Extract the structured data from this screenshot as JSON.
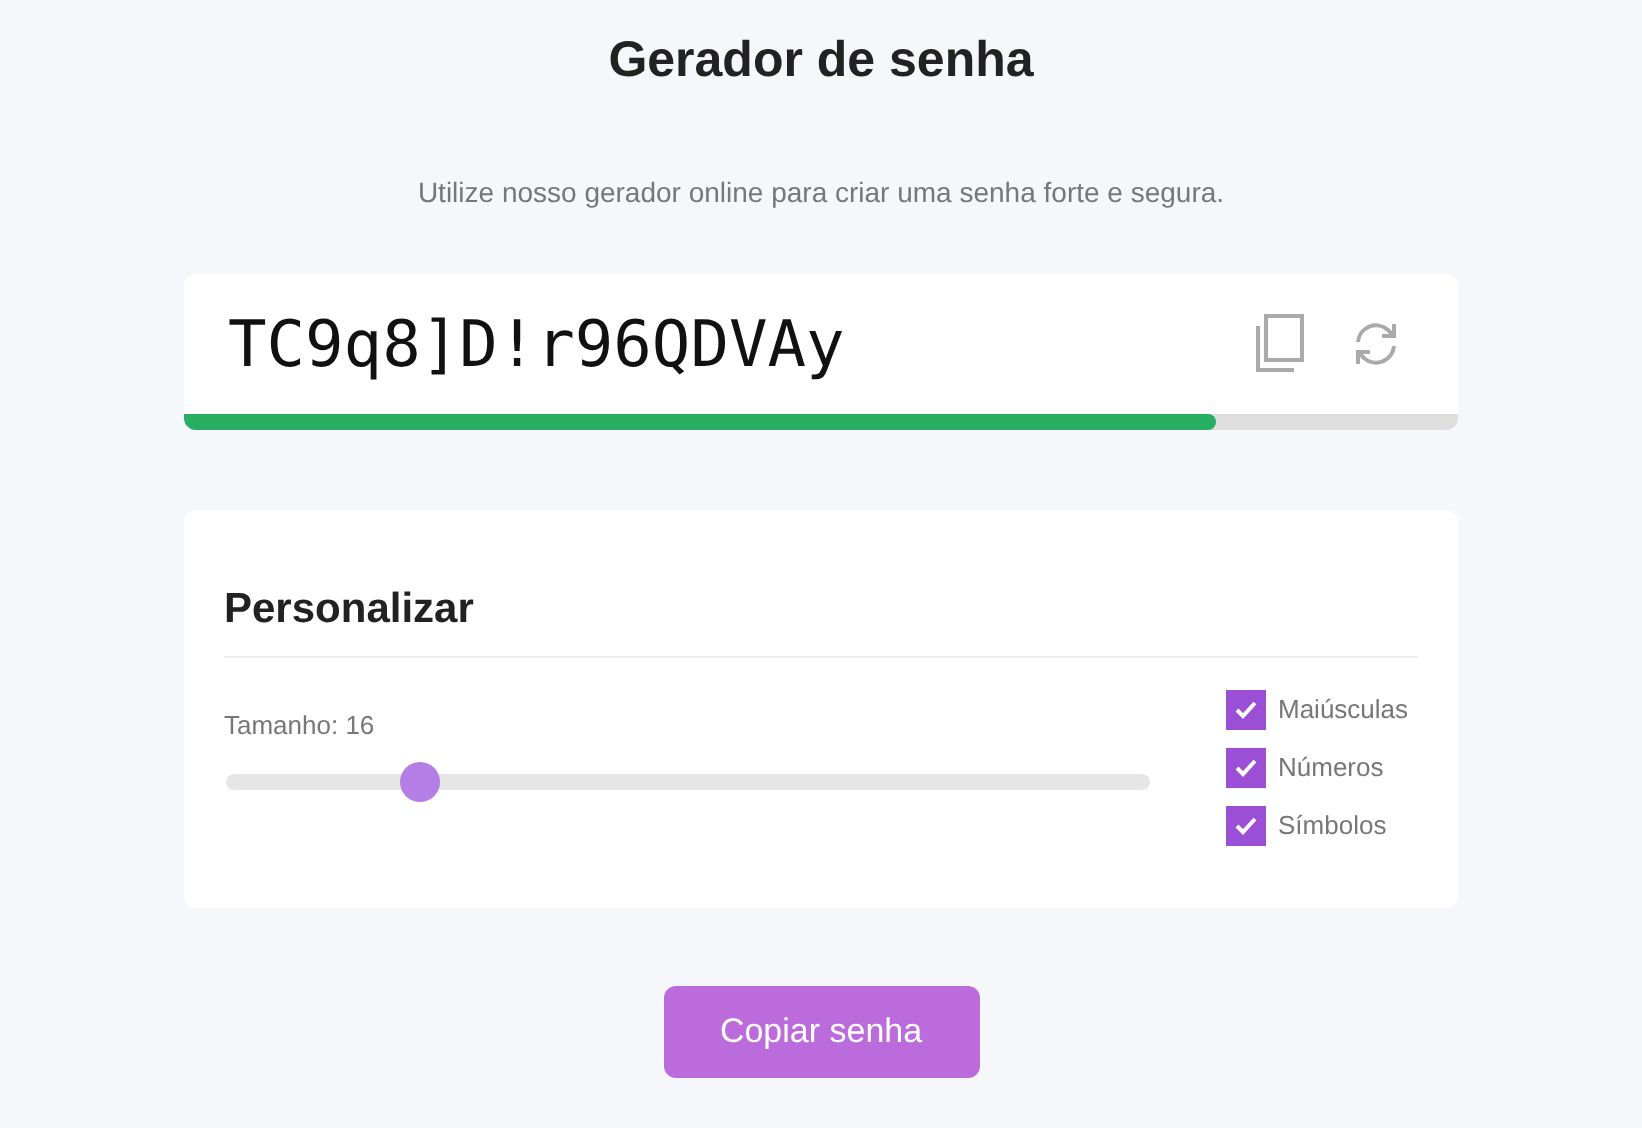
{
  "title": "Gerador de senha",
  "subtitle": "Utilize nosso gerador online para criar uma senha forte e segura.",
  "password": {
    "value": "TC9q8]D!r96QDVAy",
    "strength": {
      "level": 0.81
    }
  },
  "customize": {
    "heading": "Personalizar",
    "length_label": "Tamanho: 16",
    "slider": {
      "level": 0.21
    },
    "options": [
      {
        "label": "Maiúsculas",
        "checked": true
      },
      {
        "label": "Números",
        "checked": true
      },
      {
        "label": "Símbolos",
        "checked": true
      }
    ]
  },
  "copy_button": "Copiar senha"
}
